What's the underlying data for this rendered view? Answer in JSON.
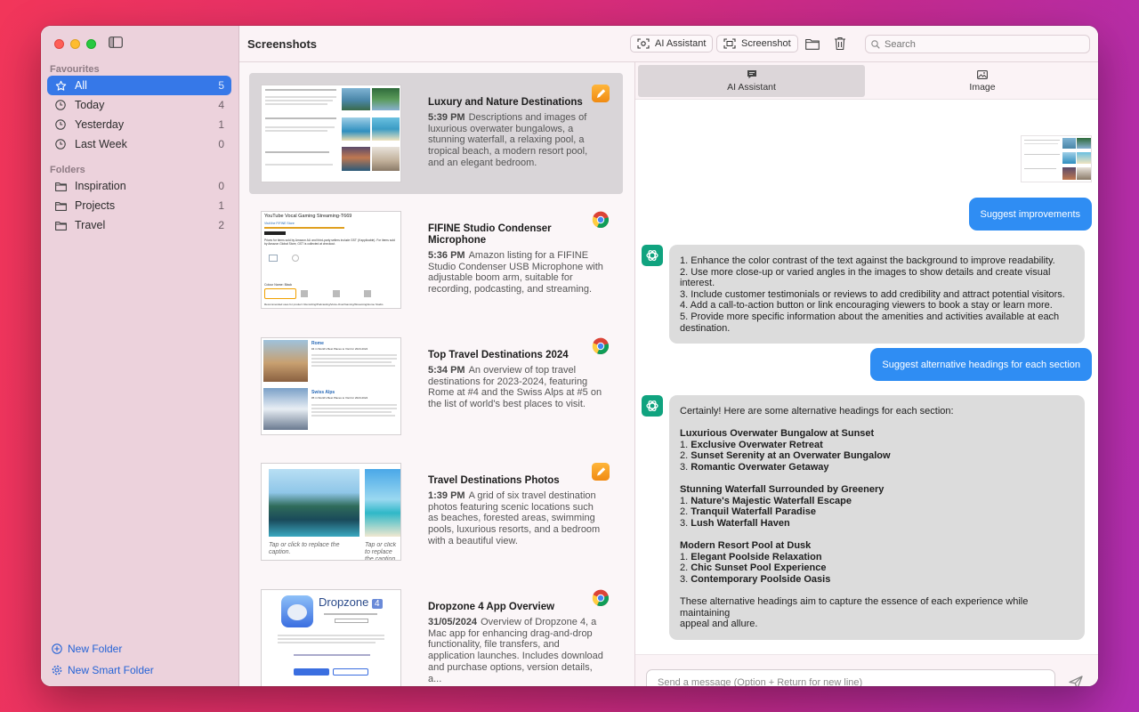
{
  "window": {
    "title": "Screenshots"
  },
  "sidebar": {
    "favourites_label": "Favourites",
    "favourites": [
      {
        "label": "All",
        "count": "5",
        "icon": "star-icon",
        "active": true
      },
      {
        "label": "Today",
        "count": "4",
        "icon": "clock-icon"
      },
      {
        "label": "Yesterday",
        "count": "1",
        "icon": "clock-icon"
      },
      {
        "label": "Last Week",
        "count": "0",
        "icon": "clock-icon"
      }
    ],
    "folders_label": "Folders",
    "folders": [
      {
        "label": "Inspiration",
        "count": "0",
        "icon": "folder-icon"
      },
      {
        "label": "Projects",
        "count": "1",
        "icon": "folder-icon"
      },
      {
        "label": "Travel",
        "count": "2",
        "icon": "folder-icon"
      }
    ],
    "new_folder": "New Folder",
    "new_smart_folder": "New Smart Folder"
  },
  "toolbar": {
    "ai_assistant": "AI Assistant",
    "screenshot": "Screenshot",
    "search_placeholder": "Search"
  },
  "items": [
    {
      "title": "Luxury and Nature Destinations",
      "time": "5:39 PM",
      "desc": "Descriptions and images of luxurious overwater bungalows, a stunning waterfall, a relaxing pool, a tropical beach, a modern resort pool, and an elegant bedroom.",
      "app_icon": "pages-icon",
      "selected": true
    },
    {
      "title": "FIFINE Studio Condenser Microphone",
      "time": "5:36 PM",
      "desc": "Amazon listing for a FIFINE Studio Condenser USB Microphone with adjustable boom arm, suitable for recording, podcasting, and streaming.",
      "app_icon": "chrome-icon",
      "thumb_heading": "YouTube Vocal Gaming Streaming-T669",
      "thumb_lines": [
        "Visit the FIFINE Store",
        "Prices for items sold by Amazon AU and third-party sellers include GST (if applicable). For items sold by Amazon Global Store, GST is collected at checkout.",
        "Colour Name: Black",
        "Recommended uses for product: Recording/Podcasting/Voice-Over/Gaming/Streaming/Home Studio"
      ]
    },
    {
      "title": "Top Travel Destinations 2024",
      "time": "5:34 PM",
      "desc": "An overview of top travel destinations for 2023-2024, featuring Rome at #4 and the Swiss Alps at #5 on the list of world's best places to visit.",
      "app_icon": "chrome-icon",
      "thumb_headings": [
        "Rome",
        "Swiss Alps"
      ],
      "thumb_sub": [
        "#4 in World's Best Places to Visit for 2023-2024",
        "#5 in World's Best Places to Visit for 2023-2024"
      ]
    },
    {
      "title": "Travel Destinations Photos",
      "time": "1:39 PM",
      "desc": "A grid of six travel destination photos featuring scenic locations such as beaches, forested areas, swimming pools, luxurious resorts, and a bedroom with a beautiful view.",
      "app_icon": "pages-icon",
      "thumb_caption": "Tap or click to replace the caption.",
      "thumb_caption2": "Tap or click to replace the caption."
    },
    {
      "title": "Dropzone 4 App Overview",
      "time": "31/05/2024",
      "desc": "Overview of Dropzone 4, a Mac app for enhancing drag-and-drop functionality, file transfers, and application launches. Includes download and purchase options, version details, a...",
      "app_icon": "chrome-icon",
      "thumb_heading": "Dropzone",
      "thumb_version": "4"
    }
  ],
  "chat": {
    "tabs": [
      {
        "label": "AI Assistant",
        "icon": "chat-bubble-icon",
        "active": true
      },
      {
        "label": "Image",
        "icon": "image-icon"
      }
    ],
    "messages": [
      {
        "role": "user",
        "text": "Suggest improvements"
      },
      {
        "role": "assistant",
        "lines": [
          {
            "t": "1. Enhance the color contrast of the text against the background to improve readability."
          },
          {
            "t": "2. Use more close-up or varied angles in the images to show details and create visual interest."
          },
          {
            "t": "3. Include customer testimonials or reviews to add credibility and attract potential visitors."
          },
          {
            "t": "4. Add a call-to-action button or link encouraging viewers to book a stay or learn more."
          },
          {
            "t": "5. Provide more specific information about the amenities and activities available at each"
          },
          {
            "t": "destination."
          }
        ]
      },
      {
        "role": "user",
        "text": "Suggest alternative headings for each section"
      },
      {
        "role": "assistant",
        "lines": [
          {
            "t": "Certainly! Here are some alternative headings for each section:"
          },
          {
            "t": ""
          },
          {
            "t": "Luxurious Overwater Bungalow at Sunset",
            "b": true
          },
          {
            "t": "1. ",
            "bt": "Exclusive Overwater Retreat"
          },
          {
            "t": "2. ",
            "bt": "Sunset Serenity at an Overwater Bungalow"
          },
          {
            "t": "3. ",
            "bt": "Romantic Overwater Getaway"
          },
          {
            "t": ""
          },
          {
            "t": "Stunning Waterfall Surrounded by Greenery",
            "b": true
          },
          {
            "t": "1. ",
            "bt": "Nature's Majestic Waterfall Escape"
          },
          {
            "t": "2. ",
            "bt": "Tranquil Waterfall Paradise"
          },
          {
            "t": "3. ",
            "bt": "Lush Waterfall Haven"
          },
          {
            "t": ""
          },
          {
            "t": "Modern Resort Pool at Dusk",
            "b": true
          },
          {
            "t": "1. ",
            "bt": "Elegant Poolside Relaxation"
          },
          {
            "t": "2. ",
            "bt": "Chic Sunset Pool Experience"
          },
          {
            "t": "3. ",
            "bt": "Contemporary Poolside Oasis"
          },
          {
            "t": ""
          },
          {
            "t": "These alternative headings aim to capture the essence of each experience while maintaining"
          },
          {
            "t": "appeal and allure."
          }
        ]
      }
    ],
    "input_placeholder": "Send a message (Option + Return for new line)"
  },
  "colors": {
    "accent": "#3678e8",
    "user_bubble": "#2f8df3",
    "assistant_avatar": "#10a37f"
  }
}
